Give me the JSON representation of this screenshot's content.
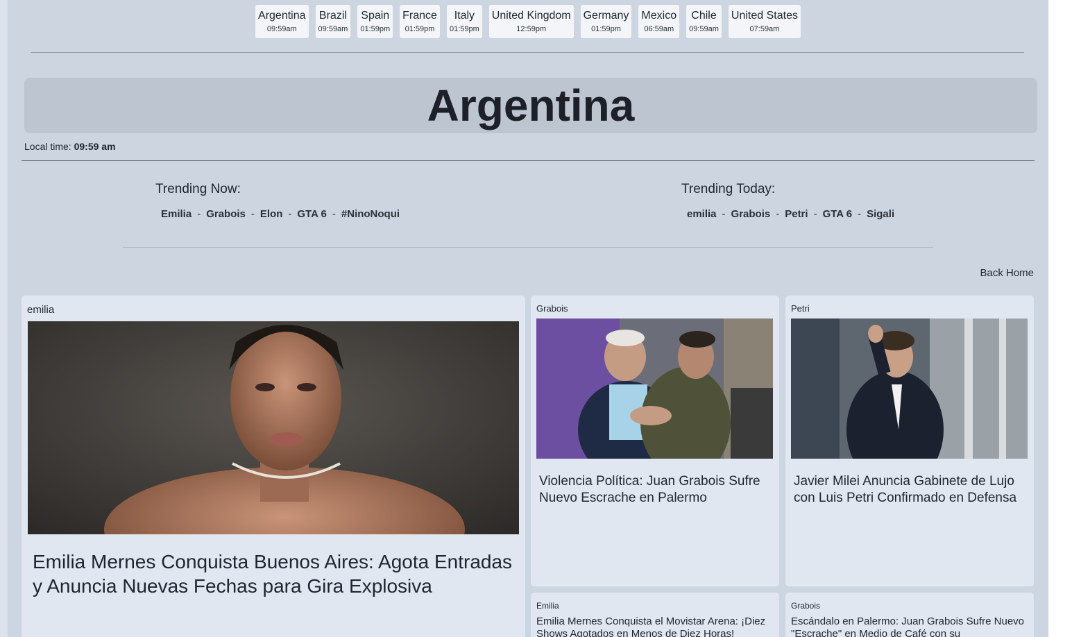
{
  "countries": [
    {
      "name": "Argentina",
      "time": "09:59am"
    },
    {
      "name": "Brazil",
      "time": "09:59am"
    },
    {
      "name": "Spain",
      "time": "01:59pm"
    },
    {
      "name": "France",
      "time": "01:59pm"
    },
    {
      "name": "Italy",
      "time": "01:59pm"
    },
    {
      "name": "United Kingdom",
      "time": "12:59pm"
    },
    {
      "name": "Germany",
      "time": "01:59pm"
    },
    {
      "name": "Mexico",
      "time": "06:59am"
    },
    {
      "name": "Chile",
      "time": "09:59am"
    },
    {
      "name": "United States",
      "time": "07:59am"
    }
  ],
  "page_title": "Argentina",
  "local_time": {
    "label": "Local time:",
    "value": "09:59 am"
  },
  "trending_now": {
    "heading": "Trending Now:",
    "items": [
      "Emilia",
      "Grabois",
      "Elon",
      "GTA 6",
      "#NinoNoqui"
    ]
  },
  "trending_today": {
    "heading": "Trending Today:",
    "items": [
      "emilia",
      "Grabois",
      "Petri",
      "GTA 6",
      "Sigali"
    ]
  },
  "trend_separator": "-",
  "back_home": "Back Home",
  "cards": [
    {
      "tag": "emilia",
      "title": "Emilia Mernes Conquista Buenos Aires: Agota Entradas y Anuncia Nuevas Fechas para Gira Explosiva",
      "image": "portrait-photo"
    },
    {
      "tag": "Grabois",
      "title": "Violencia Política: Juan Grabois Sufre Nuevo Escrache en Palermo",
      "image": "two-men-photo"
    },
    {
      "tag": "Petri",
      "title": "Javier Milei Anuncia Gabinete de Lujo con Luis Petri Confirmado en Defensa",
      "image": "man-waving-photo"
    },
    {
      "tag": "Emilia",
      "title": "Emilia Mernes Conquista el Movistar Arena: ¡Diez Shows Agotados en Menos de Diez Horas!"
    },
    {
      "tag": "Grabois",
      "title": "Escándalo en Palermo: Juan Grabois Sufre Nuevo \"Escrache\" en Medio de Café con su"
    }
  ]
}
